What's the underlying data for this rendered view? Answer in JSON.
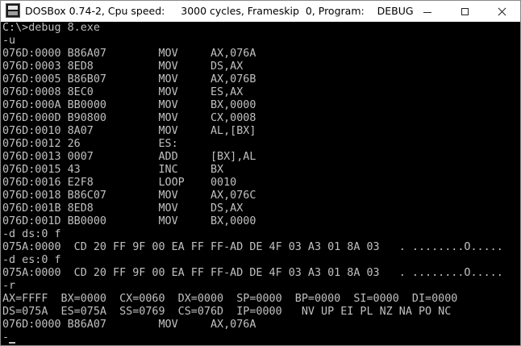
{
  "window": {
    "title": "DOSBox 0.74-2, Cpu speed:     3000 cycles, Frameskip  0, Program:    DEBUG",
    "app_icon": "dosbox-icon",
    "buttons": {
      "minimize": "minimize-icon",
      "maximize": "maximize-icon",
      "close": "close-icon"
    }
  },
  "console": {
    "text_color": "#c0c0c0",
    "background_color": "#000000",
    "lines": [
      "C:\\>debug 8.exe",
      "-u",
      "076D:0000 B86A07        MOV     AX,076A",
      "076D:0003 8ED8          MOV     DS,AX",
      "076D:0005 B86B07        MOV     AX,076B",
      "076D:0008 8EC0          MOV     ES,AX",
      "076D:000A BB0000        MOV     BX,0000",
      "076D:000D B90800        MOV     CX,0008",
      "076D:0010 8A07          MOV     AL,[BX]",
      "076D:0012 26            ES:",
      "076D:0013 0007          ADD     [BX],AL",
      "076D:0015 43            INC     BX",
      "076D:0016 E2F8          LOOP    0010",
      "076D:0018 B86C07        MOV     AX,076C",
      "076D:001B 8ED8          MOV     DS,AX",
      "076D:001D BB0000        MOV     BX,0000",
      "-d ds:0 f",
      "075A:0000  CD 20 FF 9F 00 EA FF FF-AD DE 4F 03 A3 01 8A 03   . ........O.....",
      "-d es:0 f",
      "075A:0000  CD 20 FF 9F 00 EA FF FF-AD DE 4F 03 A3 01 8A 03   . ........O.....",
      "-r",
      "AX=FFFF  BX=0000  CX=0060  DX=0000  SP=0000  BP=0000  SI=0000  DI=0000",
      "DS=075A  ES=075A  SS=0769  CS=076D  IP=0000   NV UP EI PL NZ NA PO NC",
      "076D:0000 B86A07        MOV     AX,076A",
      "-"
    ]
  }
}
